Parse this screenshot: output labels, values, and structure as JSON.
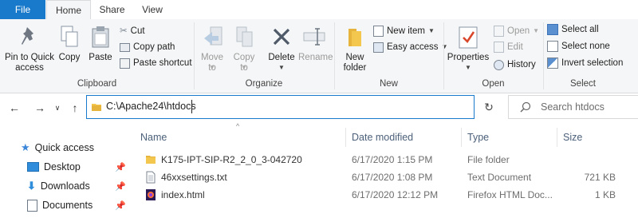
{
  "tabs": [
    {
      "label": "File",
      "active": false
    },
    {
      "label": "Home",
      "active": true
    },
    {
      "label": "Share",
      "active": false
    },
    {
      "label": "View",
      "active": false
    }
  ],
  "ribbon": {
    "clipboard": {
      "label": "Clipboard",
      "pin_to_quick_access": "Pin to Quick access",
      "copy": "Copy",
      "paste": "Paste",
      "cut": "Cut",
      "copy_path": "Copy path",
      "paste_shortcut": "Paste shortcut"
    },
    "organize": {
      "label": "Organize",
      "move_to": "Move to",
      "copy_to": "Copy to",
      "delete": "Delete",
      "rename": "Rename"
    },
    "new": {
      "label": "New",
      "new_folder": "New folder",
      "new_item": "New item",
      "easy_access": "Easy access"
    },
    "open": {
      "label": "Open",
      "properties": "Properties",
      "open": "Open",
      "edit": "Edit",
      "history": "History"
    },
    "select": {
      "label": "Select",
      "select_all": "Select all",
      "select_none": "Select none",
      "invert_selection": "Invert selection"
    }
  },
  "address": {
    "path": "C:\\Apache24\\htdocs",
    "search_placeholder": "Search htdocs"
  },
  "columns": {
    "name": "Name",
    "date_modified": "Date modified",
    "type": "Type",
    "size": "Size"
  },
  "nav_pane": [
    {
      "label": "Quick access",
      "icon": "star-icon",
      "pinned": false
    },
    {
      "label": "Desktop",
      "icon": "desktop-icon",
      "pinned": true
    },
    {
      "label": "Downloads",
      "icon": "download-icon",
      "pinned": true
    },
    {
      "label": "Documents",
      "icon": "document-icon",
      "pinned": true
    }
  ],
  "files": [
    {
      "name": "K175-IPT-SIP-R2_2_0_3-042720",
      "date": "6/17/2020 1:15 PM",
      "type": "File folder",
      "size": "",
      "icon": "folder-icon"
    },
    {
      "name": "46xxsettings.txt",
      "date": "6/17/2020 1:08 PM",
      "type": "Text Document",
      "size": "721 KB",
      "icon": "text-file-icon"
    },
    {
      "name": "index.html",
      "date": "6/17/2020 12:12 PM",
      "type": "Firefox HTML Doc...",
      "size": "1 KB",
      "icon": "html-file-icon"
    }
  ],
  "colors": {
    "accent": "#1979ca",
    "ribbon_bg": "#f5f6f7",
    "header_text": "#4c607a",
    "folder_yellow": "#f3c64e"
  }
}
